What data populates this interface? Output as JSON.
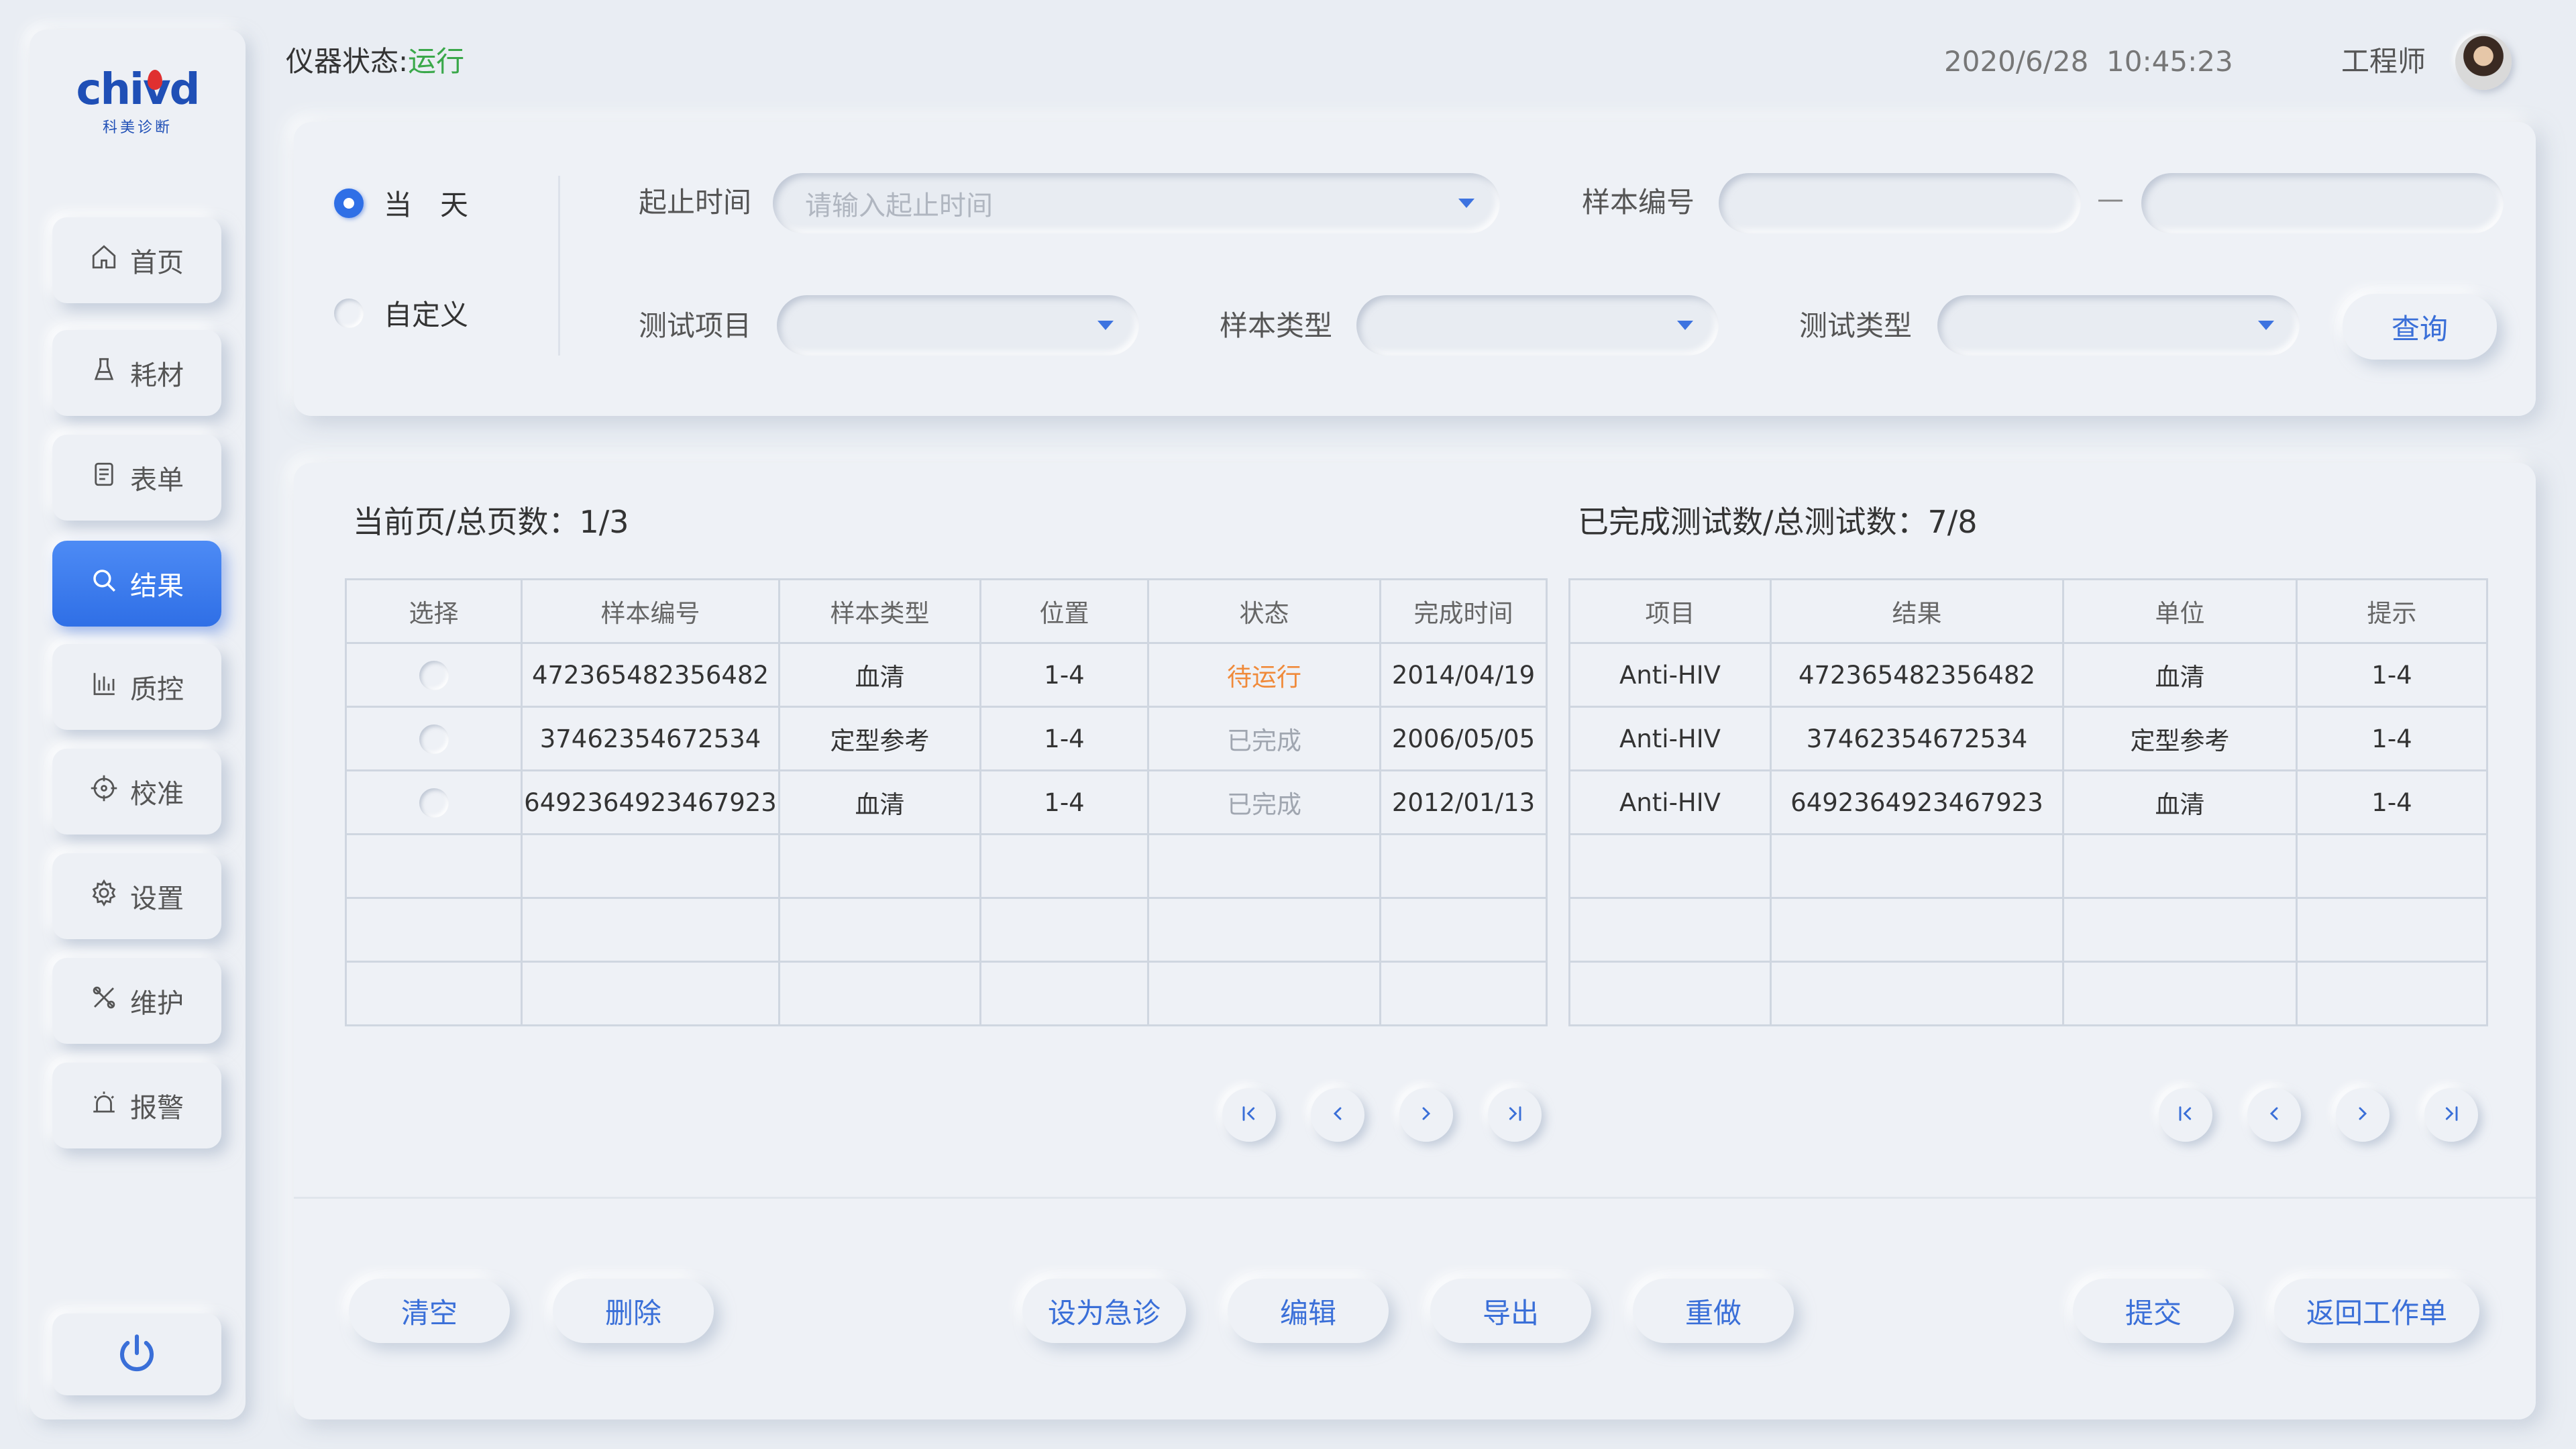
{
  "brand": {
    "logo_text": "chivd",
    "logo_sub": "科美诊断",
    "accent": "#2f6fe6"
  },
  "header": {
    "status_label": "仪器状态:",
    "status_value": "运行",
    "datetime": "2020/6/28  10:45:23",
    "user": "工程师"
  },
  "sidebar": {
    "items": [
      {
        "label": "首页",
        "icon": "home-icon"
      },
      {
        "label": "耗材",
        "icon": "flask-icon"
      },
      {
        "label": "表单",
        "icon": "form-icon"
      },
      {
        "label": "结果",
        "icon": "search-icon",
        "active": true
      },
      {
        "label": "质控",
        "icon": "bar-chart-icon"
      },
      {
        "label": "校准",
        "icon": "crosshair-icon"
      },
      {
        "label": "设置",
        "icon": "gear-icon"
      },
      {
        "label": "维护",
        "icon": "tools-icon"
      },
      {
        "label": "报警",
        "icon": "alarm-icon"
      }
    ],
    "power_icon": "power-icon"
  },
  "filter": {
    "radio_today": "当　天",
    "radio_custom": "自定义",
    "date_label": "起止时间",
    "date_placeholder": "请输入起止时间",
    "sample_no_label": "样本编号",
    "sample_no_from": "",
    "sample_no_to": "",
    "range_dash": "—",
    "test_item_label": "测试项目",
    "test_item_value": "",
    "sample_type_label": "样本类型",
    "sample_type_value": "",
    "test_type_label": "测试类型",
    "test_type_value": "",
    "query_button": "查询"
  },
  "left_table": {
    "title": "当前页/总页数：1/3",
    "headers": [
      "选择",
      "样本编号",
      "样本类型",
      "位置",
      "状态",
      "完成时间"
    ],
    "rows": [
      {
        "sample_no": "472365482356482",
        "sample_type": "血清",
        "position": "1-4",
        "status": "待运行",
        "finish_time": "2014/04/19"
      },
      {
        "sample_no": "37462354672534",
        "sample_type": "定型参考",
        "position": "1-4",
        "status": "已完成",
        "finish_time": "2006/05/05"
      },
      {
        "sample_no": "6492364923467923",
        "sample_type": "血清",
        "position": "1-4",
        "status": "已完成",
        "finish_time": "2012/01/13"
      }
    ]
  },
  "right_table": {
    "title": "已完成测试数/总测试数：7/8",
    "headers": [
      "项目",
      "结果",
      "单位",
      "提示"
    ],
    "rows": [
      {
        "item": "Anti-HIV",
        "result": "472365482356482",
        "unit": "血清",
        "hint": "1-4"
      },
      {
        "item": "Anti-HIV",
        "result": "37462354672534",
        "unit": "定型参考",
        "hint": "1-4"
      },
      {
        "item": "Anti-HIV",
        "result": "6492364923467923",
        "unit": "血清",
        "hint": "1-4"
      }
    ]
  },
  "pagination": {
    "first": "first-page-icon",
    "prev": "prev-page-icon",
    "next": "next-page-icon",
    "last": "last-page-icon"
  },
  "actions": {
    "clear": "清空",
    "delete": "删除",
    "set_urgent": "设为急诊",
    "edit": "编辑",
    "export": "导出",
    "redo": "重做",
    "submit": "提交",
    "back": "返回工作单"
  }
}
